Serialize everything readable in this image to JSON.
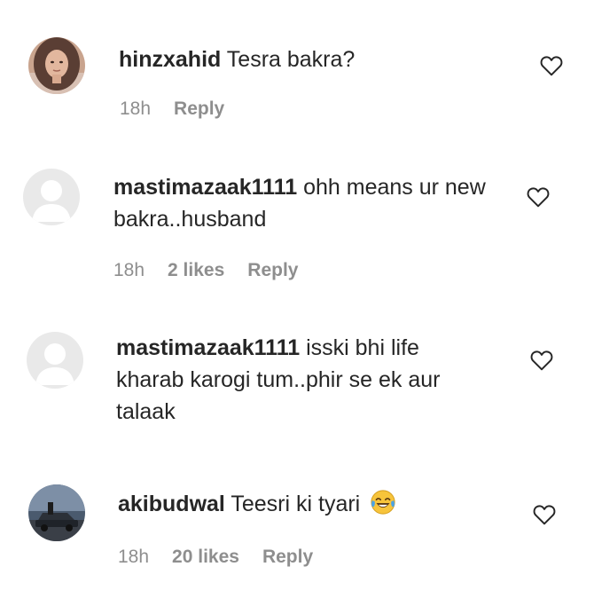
{
  "comments": [
    {
      "username": "hinzxahid",
      "text": "Tesra bakra?",
      "time": "18h",
      "likes": "",
      "reply_label": "Reply",
      "avatar": "photo-woman"
    },
    {
      "username": "mastimazaak1111",
      "text": "ohh means ur new bakra..husband",
      "time": "18h",
      "likes": "2 likes",
      "reply_label": "Reply",
      "avatar": "default-avatar"
    },
    {
      "username": "mastimazaak1111",
      "text": "isski bhi life kharab karogi tum..phir se ek aur talaak",
      "time": "",
      "likes": "",
      "reply_label": "",
      "avatar": "default-avatar"
    },
    {
      "username": "akibudwal",
      "text": "Teesri ki tyari",
      "emoji": "face-with-tears-of-joy",
      "time": "18h",
      "likes": "20 likes",
      "reply_label": "Reply",
      "avatar": "photo-car"
    }
  ],
  "icons": {
    "like": "heart-outline-icon"
  },
  "colors": {
    "text": "#262626",
    "meta": "#8e8e8e",
    "default_avatar_bg": "#e9e9e9"
  }
}
